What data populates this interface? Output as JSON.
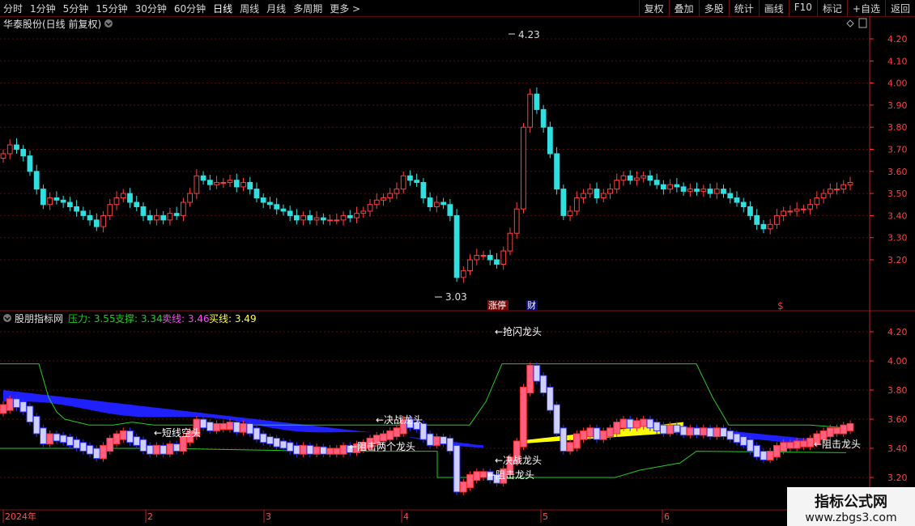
{
  "toolbar": {
    "periods": [
      "分时",
      "1分钟",
      "5分钟",
      "15分钟",
      "30分钟",
      "60分钟",
      "日线",
      "周线",
      "月线",
      "多周期",
      "更多 >"
    ],
    "active_index": 6,
    "tools": [
      "复权",
      "叠加",
      "多股",
      "统计",
      "画线",
      "F10",
      "标记",
      "+自选",
      "返回"
    ]
  },
  "upper_panel": {
    "title": "华泰股份(日线 前复权)",
    "high_label": "4.23",
    "low_label": "3.03",
    "markers": [
      "涨停",
      "财"
    ],
    "dollar_marker": "$"
  },
  "lower_panel": {
    "title": "股朋指标网",
    "lines": [
      {
        "label": "压力:",
        "value": "3.55",
        "color": "#22cc22"
      },
      {
        "label": "支撑:",
        "value": "3.34",
        "color": "#22cc22"
      },
      {
        "label": "卖线:",
        "value": "3.46",
        "color": "#ff44ff"
      },
      {
        "label": "买线:",
        "value": "3.49",
        "color": "#ffff44"
      }
    ],
    "annotations": {
      "top": "←抢闪龙头",
      "jz1": "←决战龙头",
      "short": "←短线空头",
      "zj1": "←阻击两个龙头",
      "jz2": "←决战龙头",
      "zj2": "←阻击龙头",
      "zj3": "←阻击龙头"
    }
  },
  "x_axis": {
    "labels": [
      "2024年",
      "2",
      "3",
      "4",
      "5",
      "6"
    ]
  },
  "watermark": {
    "title": "指标公式网",
    "url": "www.zbgs3.com"
  },
  "colors": {
    "up": "#ff4040",
    "down": "#30e0e0",
    "grid": "#5a0a0a",
    "axis": "#ff3030",
    "band_blue": "#2020ff",
    "band_yellow": "#ffff00",
    "green_line": "#22cc22"
  },
  "chart_data": {
    "type": "candlestick",
    "title": "华泰股份(日线 前复权)",
    "y_ticks": [
      4.2,
      4.1,
      4.0,
      3.9,
      3.8,
      3.7,
      3.6,
      3.5,
      3.4,
      3.3,
      3.2
    ],
    "lower_y_ticks": [
      4.2,
      4.0,
      3.8,
      3.6,
      3.4,
      3.2
    ],
    "ylim": [
      3.03,
      4.23
    ],
    "close": [
      3.68,
      3.72,
      3.7,
      3.67,
      3.6,
      3.52,
      3.45,
      3.48,
      3.47,
      3.46,
      3.44,
      3.42,
      3.4,
      3.38,
      3.35,
      3.4,
      3.45,
      3.48,
      3.5,
      3.46,
      3.44,
      3.4,
      3.38,
      3.4,
      3.38,
      3.41,
      3.4,
      3.46,
      3.5,
      3.58,
      3.56,
      3.54,
      3.55,
      3.55,
      3.56,
      3.53,
      3.55,
      3.52,
      3.48,
      3.46,
      3.45,
      3.43,
      3.42,
      3.4,
      3.38,
      3.4,
      3.38,
      3.39,
      3.38,
      3.38,
      3.38,
      3.4,
      3.39,
      3.41,
      3.42,
      3.45,
      3.47,
      3.48,
      3.5,
      3.52,
      3.58,
      3.56,
      3.55,
      3.48,
      3.44,
      3.46,
      3.45,
      3.4,
      3.12,
      3.15,
      3.2,
      3.22,
      3.22,
      3.2,
      3.18,
      3.24,
      3.32,
      3.43,
      3.8,
      3.95,
      3.88,
      3.8,
      3.68,
      3.52,
      3.4,
      3.42,
      3.48,
      3.5,
      3.52,
      3.48,
      3.5,
      3.52,
      3.56,
      3.58,
      3.56,
      3.57,
      3.58,
      3.56,
      3.54,
      3.52,
      3.54,
      3.53,
      3.51,
      3.52,
      3.51,
      3.52,
      3.5,
      3.52,
      3.5,
      3.48,
      3.46,
      3.44,
      3.4,
      3.36,
      3.34,
      3.36,
      3.4,
      3.42,
      3.42,
      3.43,
      3.43,
      3.45,
      3.48,
      3.5,
      3.52,
      3.52,
      3.54,
      3.55
    ]
  }
}
